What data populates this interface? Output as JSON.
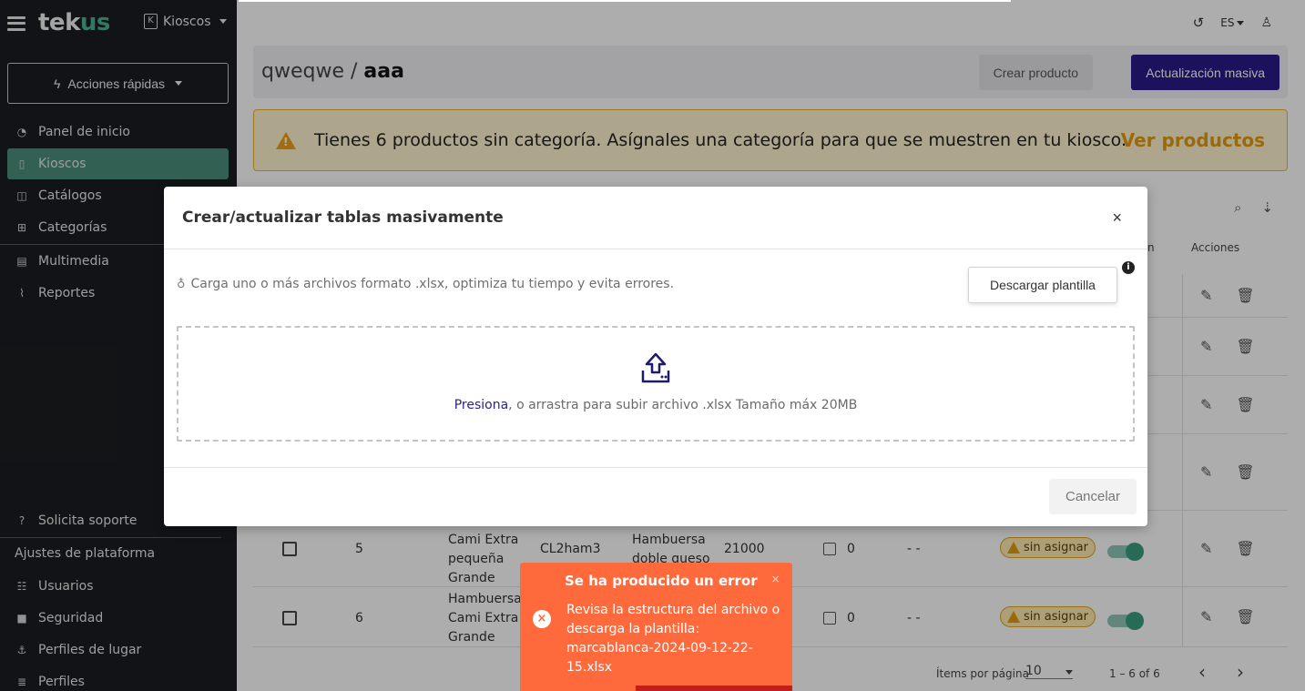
{
  "sidebar": {
    "logo_main": "tek",
    "logo_accent": "us",
    "kiosk_icon_letter": "K",
    "kiosk_switch_label": "Kioscos",
    "quick_actions_label": "Acciones rápidas",
    "items": [
      {
        "label": "Panel de inicio",
        "icon": "dashboard-icon"
      },
      {
        "label": "Kioscos",
        "icon": "kiosk-icon",
        "active": true
      },
      {
        "label": "Catálogos",
        "icon": "book-icon"
      },
      {
        "label": "Categorías",
        "icon": "sitemap-icon"
      },
      {
        "label": "Multimedia",
        "icon": "images-icon"
      },
      {
        "label": "Reportes",
        "icon": "chart-line-icon"
      }
    ],
    "support_label": "Solicita soporte",
    "platform_settings_label": "Ajustes de plataforma",
    "settings_items": [
      {
        "label": "Usuarios",
        "icon": "users-icon"
      },
      {
        "label": "Seguridad",
        "icon": "lock-icon"
      },
      {
        "label": "Perfiles de lugar",
        "icon": "place-icon"
      },
      {
        "label": "Perfiles",
        "icon": "profiles-icon"
      }
    ]
  },
  "topbar": {
    "history_icon": "history-icon",
    "language": "ES",
    "user_icon": "user-icon"
  },
  "page": {
    "breadcrumb_parent": "qweqwe",
    "breadcrumb_separator": "/",
    "breadcrumb_current": "aaa",
    "create_product_label": "Crear producto",
    "massive_update_label": "Actualización masiva"
  },
  "warning": {
    "text": "Tienes 6 productos sin categoría. Asígnales una categoría para que se muestren en tu kiosco.",
    "link": "Ver productos"
  },
  "table": {
    "partial_header": "n",
    "actions_header": "Acciones",
    "rows": [
      {
        "num": "5",
        "name_lines": [
          "Cami Extra",
          "pequeña",
          "Grande"
        ],
        "code": "CL2ham3",
        "desc_lines": [
          "Hambuersa",
          "doble queso"
        ],
        "price": "21000",
        "count": "0",
        "dash": "- -",
        "status": "sin asignar"
      },
      {
        "num": "6",
        "name_lines": [
          "Hambuersa",
          "Cami Extra",
          "Grande"
        ],
        "code": "",
        "desc_lines": [],
        "price": "",
        "count": "0",
        "dash": "- -",
        "status": "sin asignar"
      }
    ],
    "items_per_page_label": "Ítems por página",
    "items_per_page_value": "10",
    "range_label": "1 – 6 of 6"
  },
  "modal": {
    "title": "Crear/actualizar tablas masivamente",
    "close_label": "×",
    "hint": "Carga uno o más archivos formato .xlsx, optimiza tu tiempo y evita errores.",
    "download_label": "Descargar plantilla",
    "info_symbol": "i",
    "drop_link": "Presiona",
    "drop_text": ", o arrastra para subir archivo .xlsx Tamaño máx 20MB",
    "cancel_label": "Cancelar"
  },
  "toast": {
    "title": "Se ha producido un error",
    "close_label": "×",
    "icon_symbol": "×",
    "message": "Revisa la estructura del archivo o descarga la plantilla: marcablanca-2024-09-12-22-15.xlsx"
  },
  "colors": {
    "sidebar_bg": "#1b1d21",
    "active_nav": "#4a8f7c",
    "brand_accent": "#49b38f",
    "primary_button": "#2a1a8a",
    "warning_border": "#f0b429",
    "warning_link": "#e39b12",
    "toast_bg": "#ff6a3d",
    "toast_progress": "#c51d1d"
  }
}
